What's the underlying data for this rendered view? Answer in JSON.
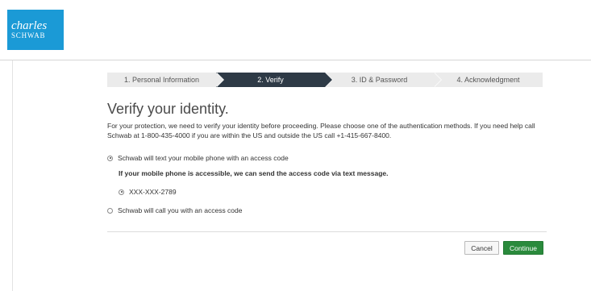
{
  "brand": {
    "logo_line1": "charles",
    "logo_line2": "SCHWAB",
    "logo_color": "#1b9ad6"
  },
  "steps": [
    {
      "label": "1. Personal Information",
      "active": false
    },
    {
      "label": "2. Verify",
      "active": true
    },
    {
      "label": "3. ID & Password",
      "active": false
    },
    {
      "label": "4. Acknowledgment",
      "active": false
    }
  ],
  "page": {
    "title": "Verify your identity.",
    "intro": "For your protection, we need to verify your identity before proceeding. Please choose one of the authentication methods. If you need help call Schwab at 1-800-435-4000 if you are within the US and outside the US call +1-415-667-8400."
  },
  "options": {
    "text_option": {
      "label": "Schwab will text your mobile phone with an access code",
      "checked": true,
      "note": "If your mobile phone is accessible, we can send the access code via text message.",
      "phone": {
        "label": "XXX-XXX-2789",
        "checked": true
      }
    },
    "call_option": {
      "label": "Schwab will call you with an access code",
      "checked": false
    }
  },
  "buttons": {
    "cancel": "Cancel",
    "continue": "Continue",
    "continue_color": "#2a8a3c",
    "active_step_color": "#2e3a46"
  }
}
